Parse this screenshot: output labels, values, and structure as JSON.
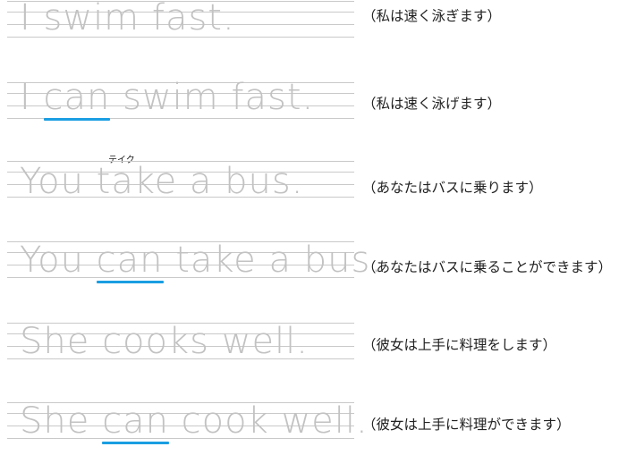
{
  "rows": [
    {
      "before": "I ",
      "can": "",
      "after": "swim fast.",
      "translation": "（私は速く泳ぎます）"
    },
    {
      "before": "I ",
      "can": "can",
      "after": " swim fast.",
      "translation": "（私は速く泳げます）"
    },
    {
      "before": "You take a bus.",
      "can": "",
      "after": "",
      "translation": "（あなたはバスに乗ります）",
      "ruby": "テイク"
    },
    {
      "before": "You ",
      "can": "can",
      "after": " take a bus.",
      "translation": "（あなたはバスに乗ることができます）"
    },
    {
      "before": "She cooks well.",
      "can": "",
      "after": "",
      "translation": "（彼女は上手に料理をします）"
    },
    {
      "before": "She ",
      "can": "can",
      "after": " cook well.",
      "translation": "（彼女は上手に料理ができます）"
    }
  ]
}
